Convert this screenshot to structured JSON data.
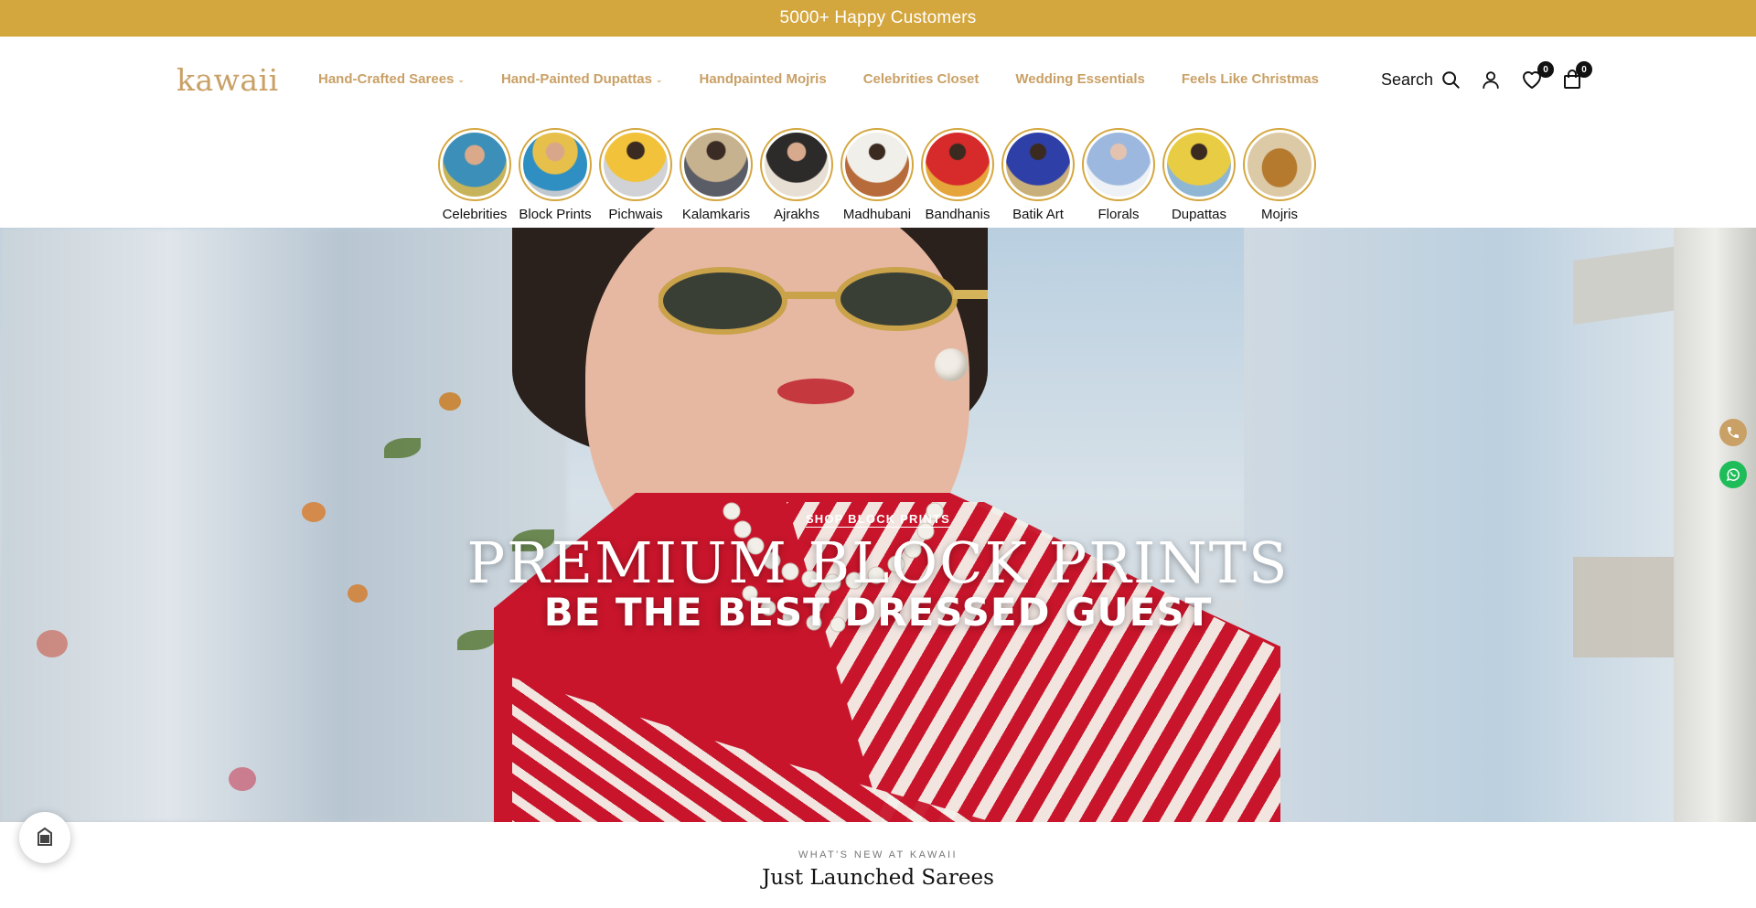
{
  "announcement": {
    "text": "5000+ Happy Customers"
  },
  "brand": {
    "logo_text": "kawaii",
    "accent_color": "#d4a63e",
    "nav_color": "#c9a066"
  },
  "nav": {
    "items": [
      {
        "label": "Hand-Crafted Sarees",
        "has_dropdown": true
      },
      {
        "label": "Hand-Painted Dupattas",
        "has_dropdown": true
      },
      {
        "label": "Handpainted Mojris",
        "has_dropdown": false
      },
      {
        "label": "Celebrities Closet",
        "has_dropdown": false
      },
      {
        "label": "Wedding Essentials",
        "has_dropdown": false
      },
      {
        "label": "Feels Like Christmas",
        "has_dropdown": false
      }
    ],
    "chevron": "⌄"
  },
  "header_actions": {
    "search_label": "Search",
    "wishlist_count": "0",
    "cart_count": "0"
  },
  "categories": [
    {
      "label": "Celebrities"
    },
    {
      "label": "Block Prints"
    },
    {
      "label": "Pichwais"
    },
    {
      "label": "Kalamkaris"
    },
    {
      "label": "Ajrakhs"
    },
    {
      "label": "Madhubani"
    },
    {
      "label": "Bandhanis"
    },
    {
      "label": "Batik Art"
    },
    {
      "label": "Florals"
    },
    {
      "label": "Dupattas"
    },
    {
      "label": "Mojris"
    }
  ],
  "hero": {
    "kicker_link": "SHOP BLOCK PRINTS",
    "title": "PREMIUM BLOCK PRINTS",
    "subtitle": "BE THE BEST DRESSED GUEST"
  },
  "section": {
    "kicker": "WHAT'S NEW AT KAWAII",
    "title": "Just Launched Sarees"
  }
}
